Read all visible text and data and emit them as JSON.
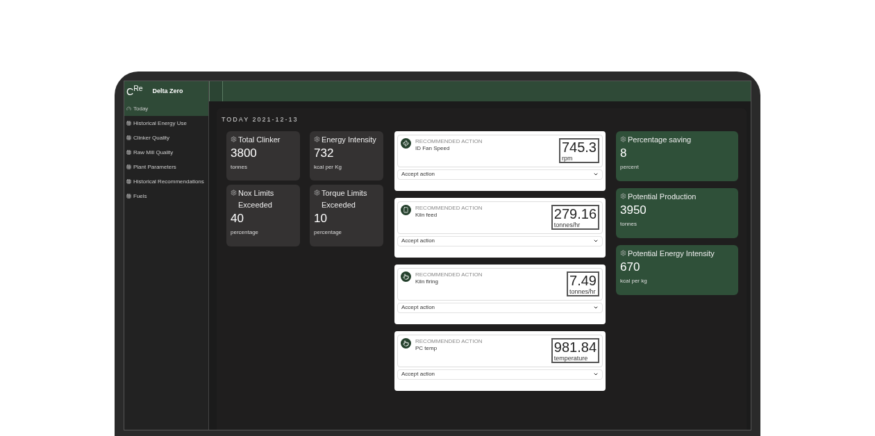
{
  "app": {
    "logo": "C$^{Re}$",
    "name": "Delta Zero"
  },
  "sidebar": {
    "items": [
      {
        "label": "Today",
        "selected": true
      },
      {
        "label": "Historical Energy Use",
        "selected": false
      },
      {
        "label": "Clinker Quality",
        "selected": false
      },
      {
        "label": "Raw Mill Quality",
        "selected": false
      },
      {
        "label": "Plant Parameters",
        "selected": false
      },
      {
        "label": "Historical Recommendations",
        "selected": false
      },
      {
        "label": "Fuels",
        "selected": false
      }
    ]
  },
  "page_title": "TODAY 2021-12-13",
  "stats": [
    {
      "title": "Total Clinker",
      "value": "3800",
      "unit": "tonnes"
    },
    {
      "title": "Energy Intensity",
      "value": "732",
      "unit": "kcal per Kg"
    },
    {
      "title": "Nox Limits Exceeded",
      "value": "40",
      "unit": "percentage"
    },
    {
      "title": "Torque Limits Exceeded",
      "value": "10",
      "unit": "percentage"
    }
  ],
  "recommendations": [
    {
      "label": "RECOMMENDED ACTION",
      "name": "ID Fan Speed",
      "value": "745.3",
      "unit": "rpm",
      "action": "Accept action"
    },
    {
      "label": "RECOMMENDED ACTION",
      "name": "Kiln feed",
      "value": "279.16",
      "unit": "tonnes/hr",
      "action": "Accept action"
    },
    {
      "label": "RECOMMENDED ACTION",
      "name": "Kiln firing",
      "value": "7.49",
      "unit": "tonnes/hr",
      "action": "Accept action"
    },
    {
      "label": "RECOMMENDED ACTION",
      "name": "PC temp",
      "value": "981.84",
      "unit": "temperature",
      "action": "Accept action"
    }
  ],
  "savings": [
    {
      "title": "Percentage saving",
      "value": "8",
      "unit": "percent"
    },
    {
      "title": "Potential Production",
      "value": "3950",
      "unit": "tonnes"
    },
    {
      "title": "Potential Energy Intensity",
      "value": "670",
      "unit": "kcal per kg"
    }
  ]
}
